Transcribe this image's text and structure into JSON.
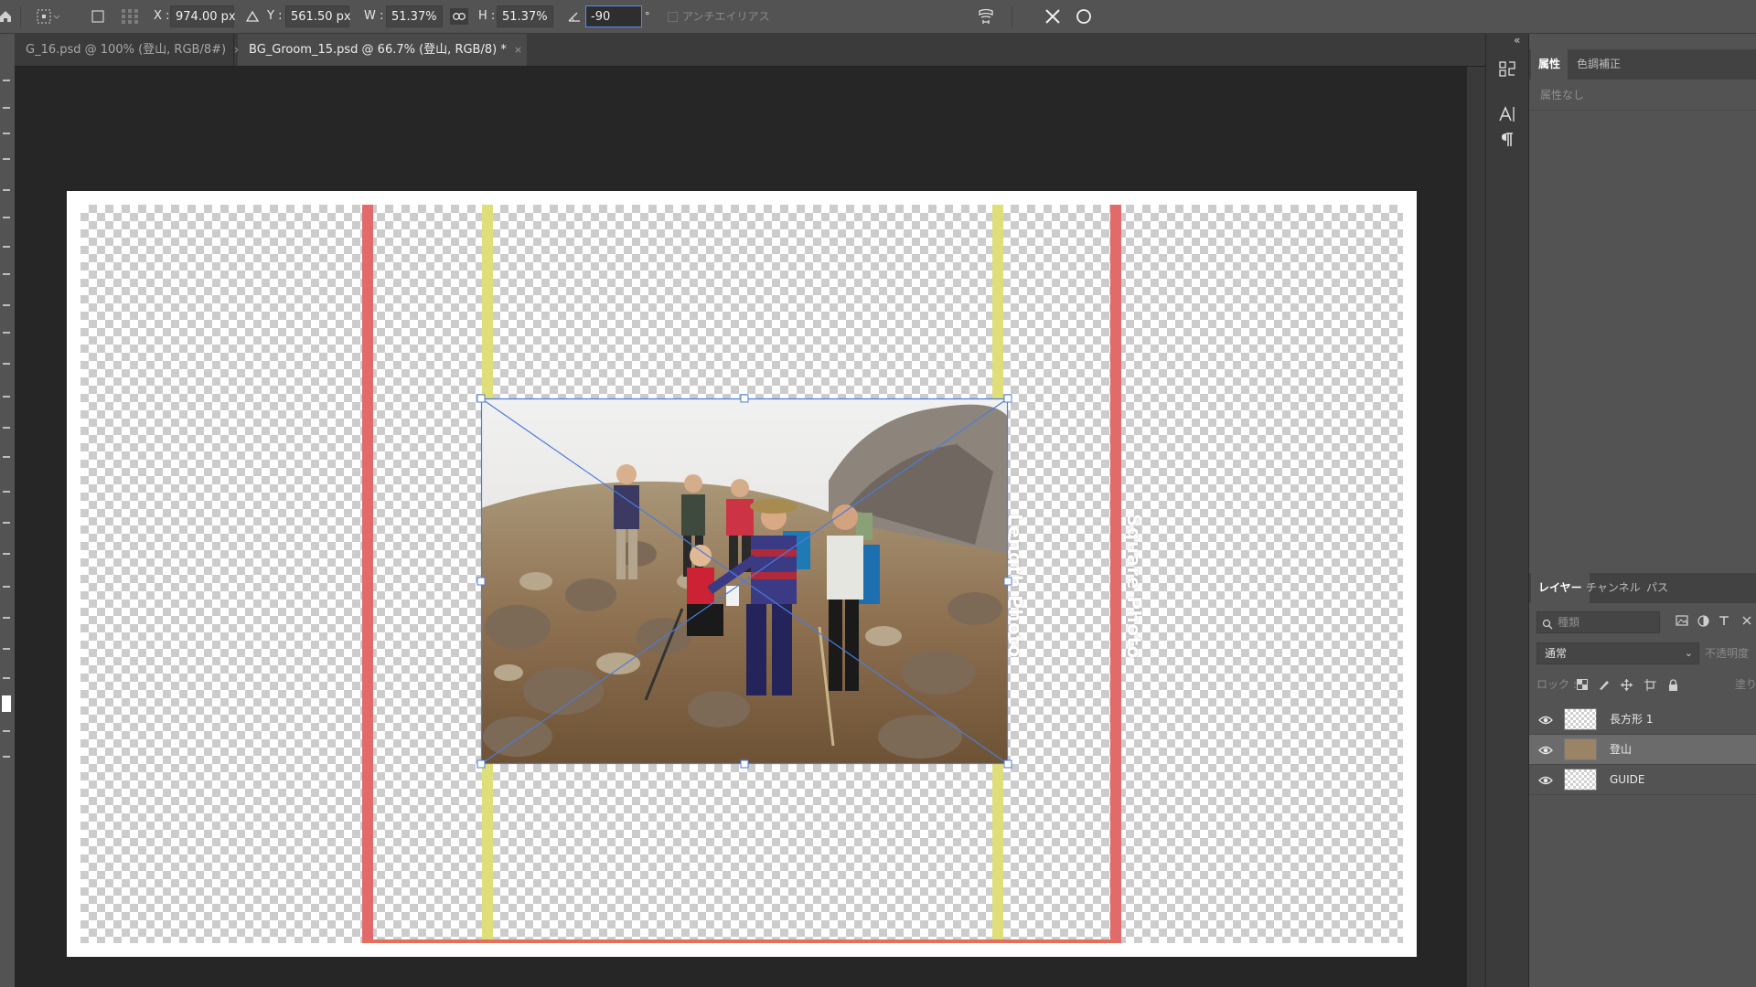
{
  "options_bar": {
    "x_label": "X :",
    "x_value": "974.00 px",
    "y_label": "Y :",
    "y_value": "561.50 px",
    "w_label": "W :",
    "w_value": "51.37%",
    "h_label": "H :",
    "h_value": "51.37%",
    "angle_value": "-90",
    "angle_unit": "°",
    "antialias_label": "アンチエイリアス"
  },
  "tabs": [
    {
      "label": "G_16.psd @ 100% (登山, RGB/8#)",
      "close": "×"
    },
    {
      "label": "BG_Groom_15.psd @ 66.7% (登山, RGB/8) *",
      "close": "×"
    }
  ],
  "canvas": {
    "label_length": "Length Photo",
    "label_square": "Square Photo"
  },
  "properties_panel": {
    "tabs": [
      "属性",
      "色調補正"
    ],
    "empty_text": "属性なし"
  },
  "layers_panel": {
    "tabs": [
      "レイヤー",
      "チャンネル",
      "パス"
    ],
    "search_placeholder": "種類",
    "blend_mode": "通常",
    "opacity_label": "不透明度",
    "lock_label": "ロック :",
    "fill_label": "塗り",
    "layers": [
      {
        "name": "長方形 1",
        "selected": false
      },
      {
        "name": "登山",
        "selected": true
      },
      {
        "name": "GUIDE",
        "selected": false
      }
    ]
  },
  "colors": {
    "guide_red": "#e26a6a",
    "guide_yellow": "#dede7a",
    "transform_blue": "#4d7bdc",
    "panel_bg": "#535353"
  }
}
